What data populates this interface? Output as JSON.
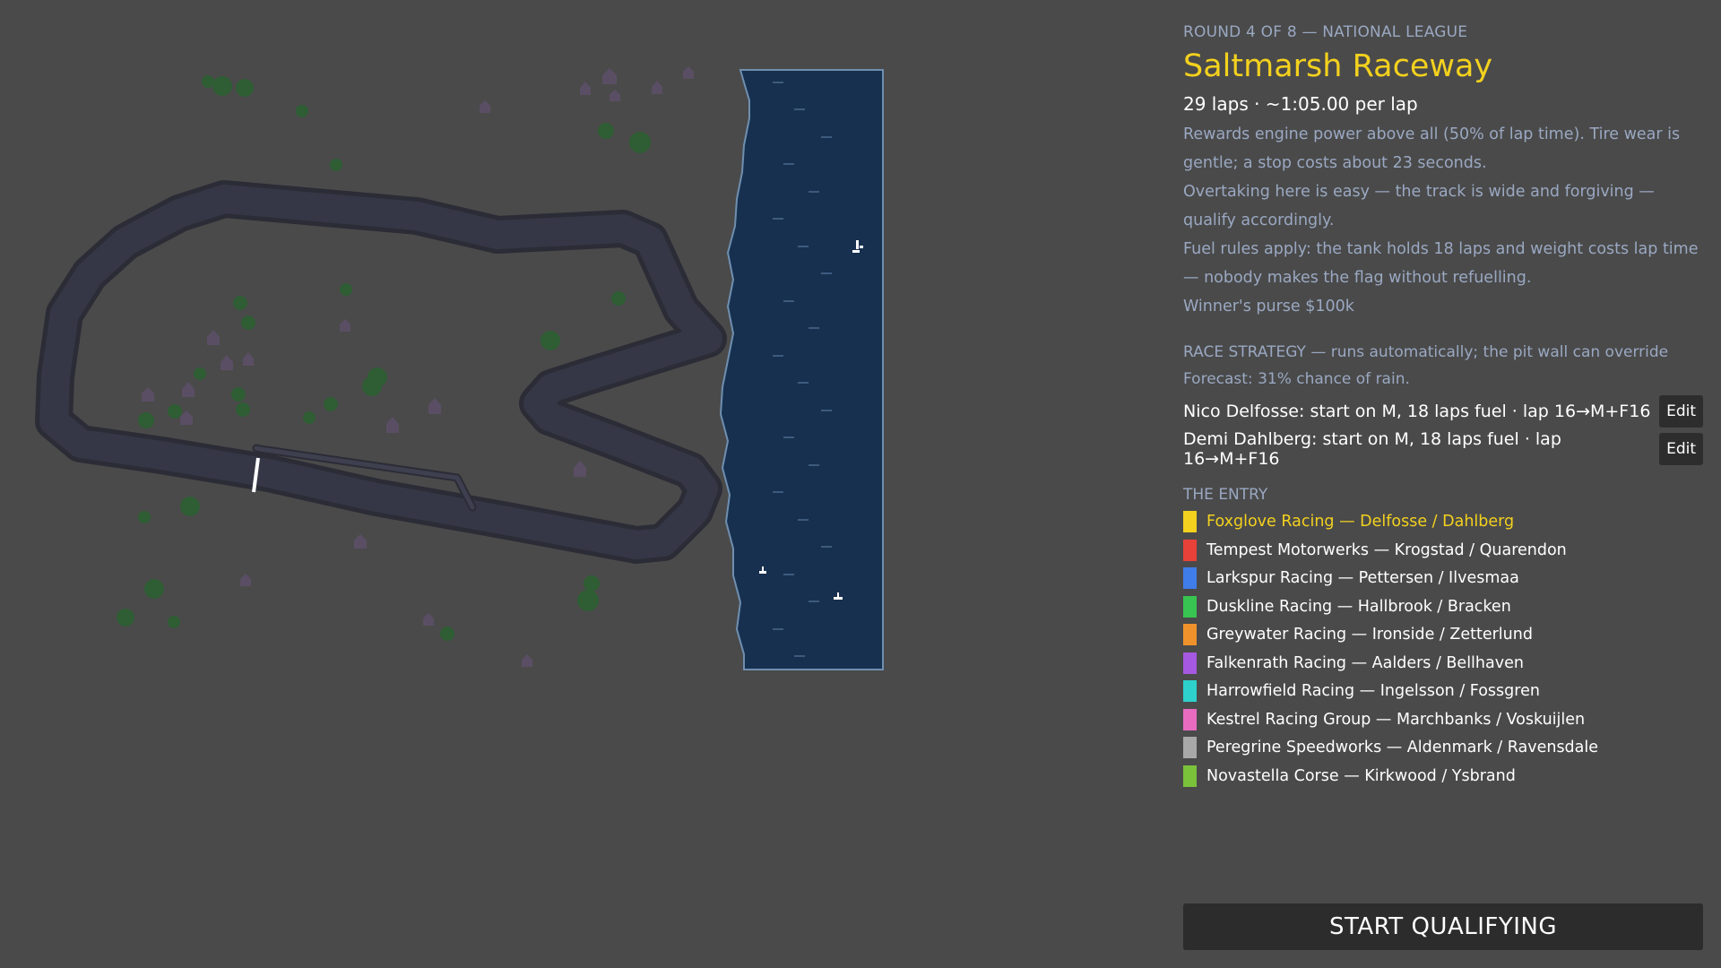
{
  "header": {
    "round_label": "ROUND 4 OF 8 — NATIONAL LEAGUE",
    "track_name": "Saltmarsh Raceway",
    "race_summary": "29 laps · ~1:05.00 per lap"
  },
  "description": [
    "Rewards engine power above all (50% of lap time). Tire wear is gentle; a stop costs about 23 seconds.",
    "Overtaking here is easy — the track is wide and forgiving — qualify accordingly.",
    "Fuel rules apply: the tank holds 18 laps and weight costs lap time — nobody makes the flag without refuelling.",
    "Winner's purse $100k"
  ],
  "strategy": {
    "header": "RACE STRATEGY — runs automatically; the pit wall can override",
    "forecast": "Forecast: 31% chance of rain.",
    "drivers": [
      {
        "text": "Nico Delfosse: start on M, 18 laps fuel · lap 16→M+F16",
        "edit_label": "Edit"
      },
      {
        "text": "Demi Dahlberg: start on M, 18 laps fuel · lap 16→M+F16",
        "edit_label": "Edit"
      }
    ]
  },
  "entry": {
    "header": "THE ENTRY",
    "teams": [
      {
        "text": "Foxglove Racing — Delfosse / Dahlberg",
        "color": "#f3d11e",
        "player": true
      },
      {
        "text": "Tempest Motorwerks — Krogstad / Quarendon",
        "color": "#e8413a",
        "player": false
      },
      {
        "text": "Larkspur Racing — Pettersen / Ilvesmaa",
        "color": "#3f7de8",
        "player": false
      },
      {
        "text": "Duskline Racing — Hallbrook / Bracken",
        "color": "#38c450",
        "player": false
      },
      {
        "text": "Greywater Racing — Ironside / Zetterlund",
        "color": "#f0922b",
        "player": false
      },
      {
        "text": "Falkenrath Racing — Aalders / Bellhaven",
        "color": "#a558e0",
        "player": false
      },
      {
        "text": "Harrowfield Racing — Ingelsson / Fossgren",
        "color": "#2ed0cc",
        "player": false
      },
      {
        "text": "Kestrel Racing Group — Marchbanks / Voskuijlen",
        "color": "#e86bc0",
        "player": false
      },
      {
        "text": "Peregrine Speedworks — Aldenmark / Ravensdale",
        "color": "#a8a8a8",
        "player": false
      },
      {
        "text": "Novastella Corse — Kirkwood / Ysbrand",
        "color": "#7ac23a",
        "player": false
      }
    ]
  },
  "actions": {
    "start_label": "START QUALIFYING"
  },
  "colors": {
    "background": "#4a4a4a",
    "track": "#353746",
    "track_edge": "#2b2c36",
    "water": "#17304f",
    "shore": "#6f8fb0",
    "tree": "#2f5d34",
    "house": "#5a4e64",
    "accent": "#f3d11e"
  }
}
